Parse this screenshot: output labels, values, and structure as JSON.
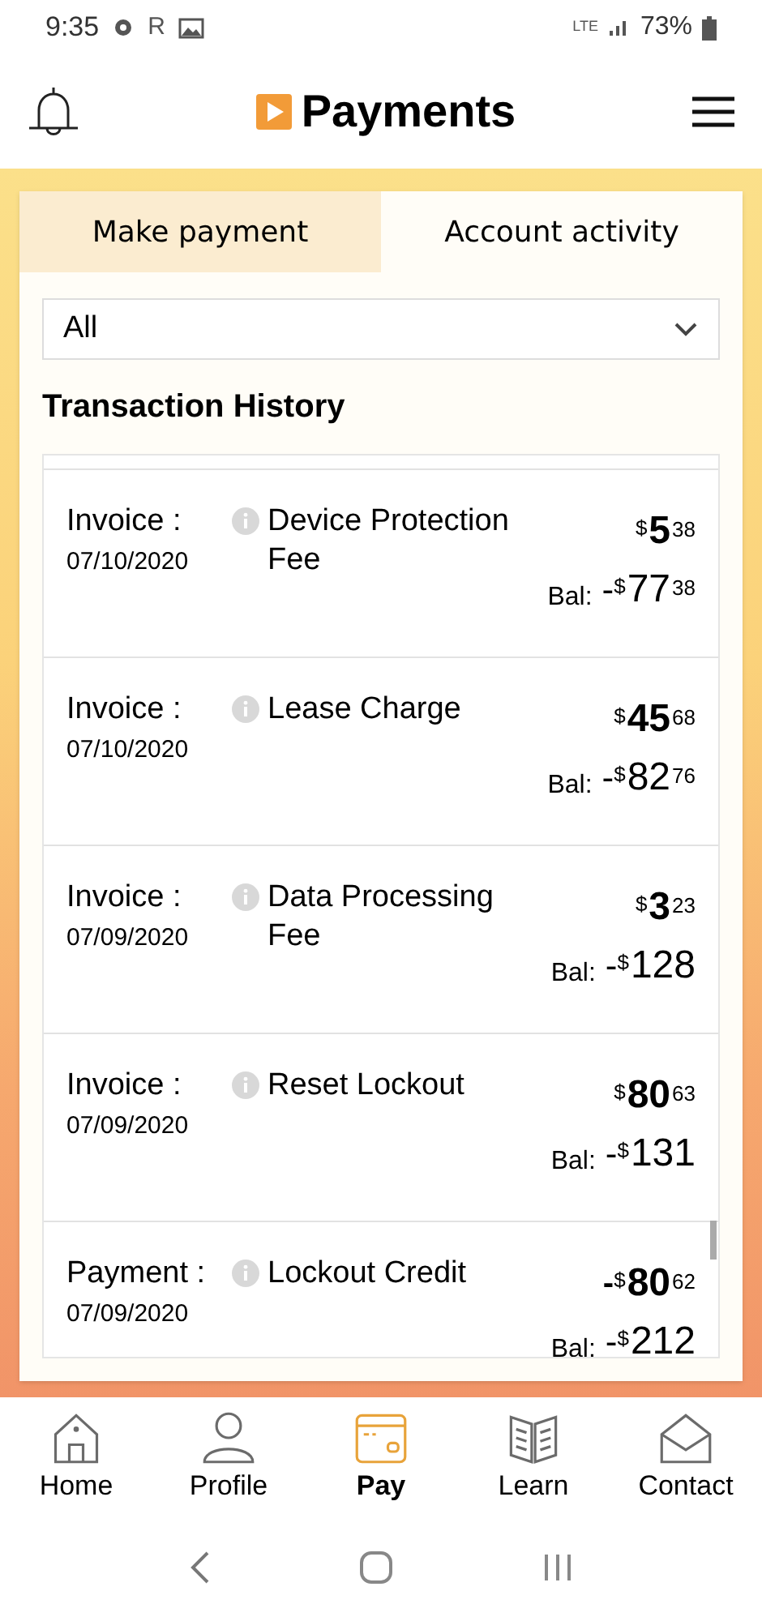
{
  "status_bar": {
    "time": "9:35",
    "carrier_letter": "R",
    "network": "LTE",
    "battery": "73%"
  },
  "header": {
    "title": "Payments"
  },
  "tabs": [
    {
      "label": "Make payment",
      "selected": false
    },
    {
      "label": "Account activity",
      "selected": true
    }
  ],
  "filter": {
    "value": "All"
  },
  "section_title": "Transaction History",
  "transactions": [
    {
      "type": "Invoice :",
      "date": "07/10/2020",
      "description": "Device Protection Fee",
      "amount": {
        "currency": "$",
        "whole": "5",
        "cents": "38"
      },
      "balance_label": "Bal:",
      "balance": {
        "sign": "-",
        "currency": "$",
        "whole": "77",
        "cents": "38"
      }
    },
    {
      "type": "Invoice :",
      "date": "07/10/2020",
      "description": "Lease Charge",
      "amount": {
        "currency": "$",
        "whole": "45",
        "cents": "68"
      },
      "balance_label": "Bal:",
      "balance": {
        "sign": "-",
        "currency": "$",
        "whole": "82",
        "cents": "76"
      }
    },
    {
      "type": "Invoice :",
      "date": "07/09/2020",
      "description": "Data Processing Fee",
      "amount": {
        "currency": "$",
        "whole": "3",
        "cents": "23"
      },
      "balance_label": "Bal:",
      "balance": {
        "sign": "-",
        "currency": "$",
        "whole": "128"
      }
    },
    {
      "type": "Invoice :",
      "date": "07/09/2020",
      "description": "Reset Lockout",
      "amount": {
        "currency": "$",
        "whole": "80",
        "cents": "63"
      },
      "balance_label": "Bal:",
      "balance": {
        "sign": "-",
        "currency": "$",
        "whole": "131"
      }
    },
    {
      "type": "Payment :",
      "date": "07/09/2020",
      "description": "Lockout Credit",
      "amount": {
        "sign": "-",
        "currency": "$",
        "whole": "80",
        "cents": "62"
      },
      "balance_label": "Bal:",
      "balance": {
        "sign": "-",
        "currency": "$",
        "whole": "212"
      }
    }
  ],
  "bottom_nav": [
    {
      "kind": "home",
      "label": "Home",
      "selected": false
    },
    {
      "kind": "profile",
      "label": "Profile",
      "selected": false
    },
    {
      "kind": "pay",
      "label": "Pay",
      "selected": true
    },
    {
      "kind": "learn",
      "label": "Learn",
      "selected": false
    },
    {
      "kind": "contact",
      "label": "Contact",
      "selected": false
    }
  ]
}
